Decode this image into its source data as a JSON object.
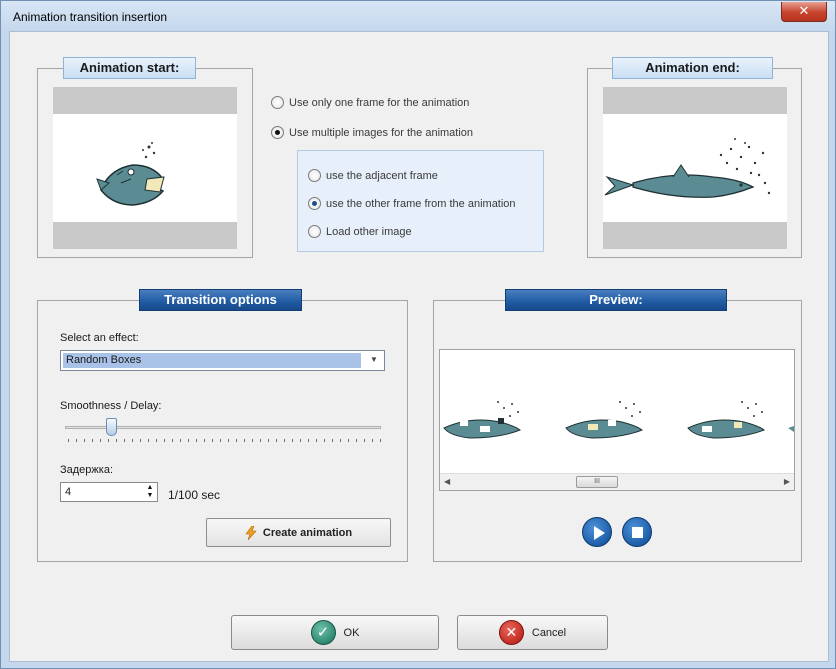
{
  "window": {
    "title": "Animation transition insertion",
    "close_glyph": "✕"
  },
  "animation_start": {
    "title": "Animation start:"
  },
  "animation_end": {
    "title": "Animation end:"
  },
  "frame_mode": {
    "options": [
      {
        "label": "Use only one frame for the animation",
        "checked": false
      },
      {
        "label": "Use multiple images for the animation",
        "checked": true
      }
    ],
    "sub_options": [
      {
        "label": "use the adjacent frame",
        "checked": false
      },
      {
        "label": "use the other frame from the animation",
        "checked": true
      },
      {
        "label": "Load other image",
        "checked": false
      }
    ]
  },
  "transition_options": {
    "title": "Transition options",
    "effect_label": "Select an effect:",
    "effect_value": "Random Boxes",
    "smoothness_label": "Smoothness / Delay:",
    "smoothness_level": 0.15,
    "delay_label": "Задержка:",
    "delay_value": "4",
    "delay_unit": "1/100 sec",
    "create_button": "Create animation"
  },
  "preview": {
    "title": "Preview:",
    "scroll_thumb_glyph": "III",
    "play_icon": "play-icon",
    "stop_icon": "stop-icon"
  },
  "footer": {
    "ok_label": "OK",
    "cancel_label": "Cancel"
  },
  "colors": {
    "accent_dark": "#1f5aa3",
    "fish_body": "#5b8c93",
    "ok_green": "#2f8a73",
    "cancel_red": "#c42c22"
  }
}
